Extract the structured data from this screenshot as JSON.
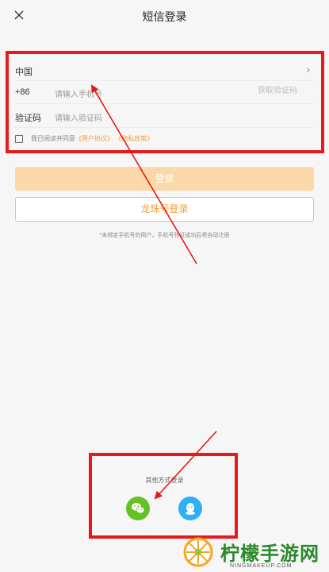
{
  "header": {
    "title": "短信登录"
  },
  "form": {
    "region": "中国",
    "country_code": "+86",
    "phone_placeholder": "请输入手机号",
    "sms_button": "获取验证码",
    "code_label": "验证码",
    "code_placeholder": "请输入验证码"
  },
  "agreement": {
    "prefix": "我已阅读并同意",
    "user_agreement": "《用户协议》",
    "privacy_policy": "《隐私政策》"
  },
  "buttons": {
    "login": "登录",
    "dragon_login": "龙珠号登录"
  },
  "tip": "*未绑定手机号的用户，手机号验证成功后将自动注册",
  "other_login": {
    "title": "其他方式登录",
    "options": [
      {
        "name": "wechat",
        "icon": "wechat-icon",
        "color": "#66c223"
      },
      {
        "name": "qq",
        "icon": "qq-icon",
        "color": "#2faff5"
      }
    ]
  },
  "annotation": {
    "color": "#e8191a"
  },
  "watermark": {
    "name": "柠檬手游网",
    "url": "NINGMAKEUP.COM"
  }
}
